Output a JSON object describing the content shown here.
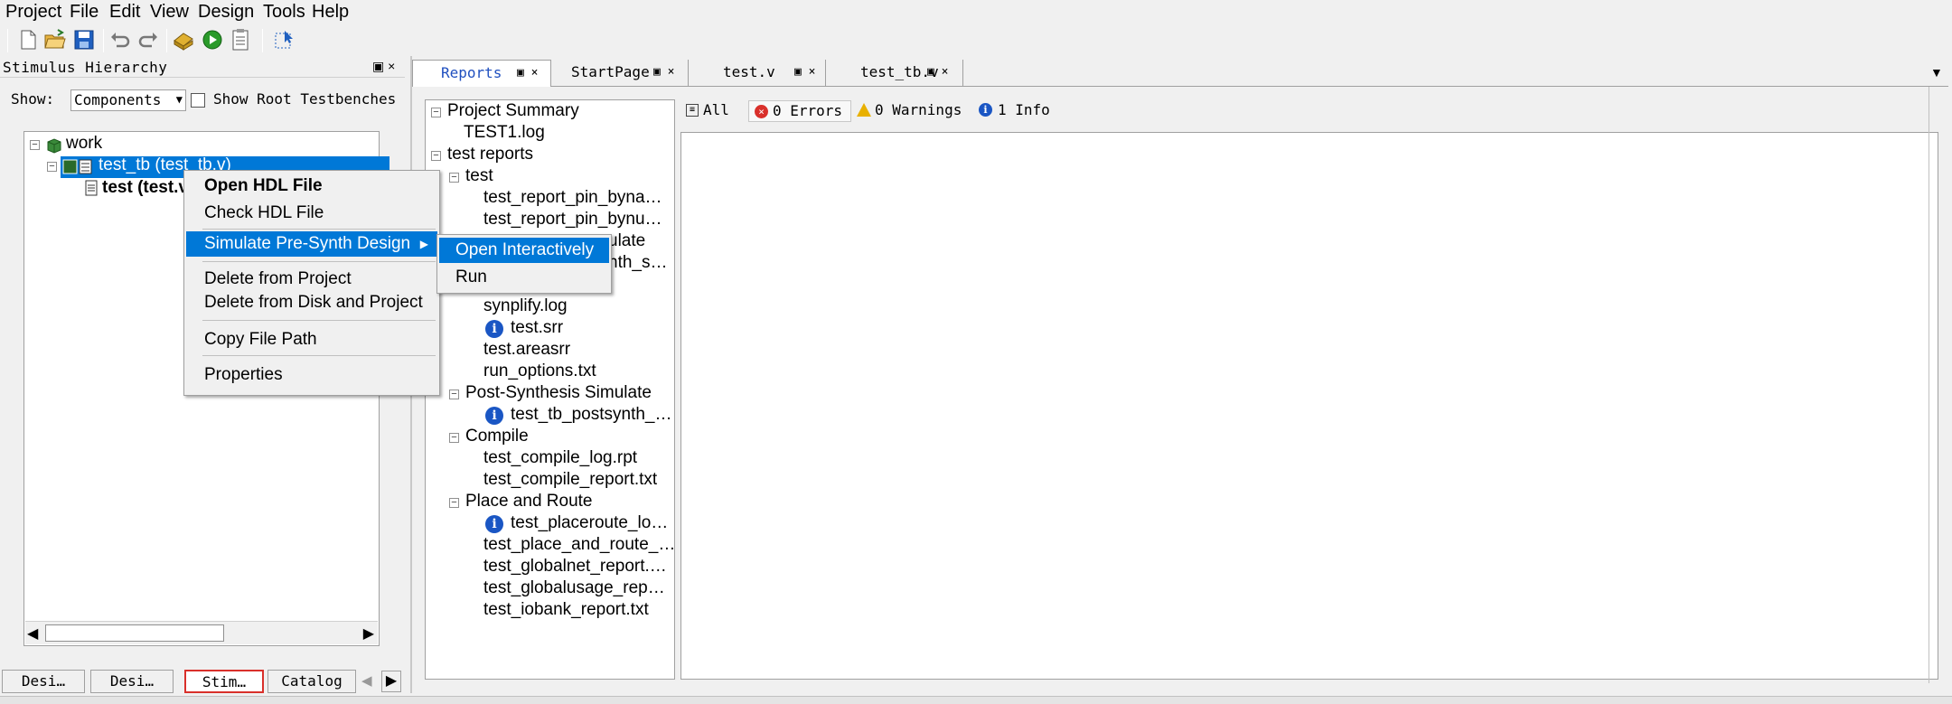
{
  "menubar": {
    "items": [
      "Project",
      "File",
      "Edit",
      "View",
      "Design",
      "Tools",
      "Help"
    ]
  },
  "toolbar": {
    "icons": [
      "new-file-icon",
      "open-folder-icon",
      "save-icon",
      "undo-icon",
      "redo-icon",
      "build-icon",
      "run-icon",
      "report-icon",
      "select-icon"
    ]
  },
  "left_panel": {
    "title": "Stimulus Hierarchy",
    "dock_label": "▣ ×",
    "show_label": "Show:",
    "show_select": "Components",
    "root_testbenches_label": "Show Root Testbenches",
    "tree": {
      "work": "work",
      "test_tb": "test_tb (test_tb.v)",
      "test_v": "test (test.v)"
    },
    "bottom_tabs": [
      "Desi…",
      "Desi…",
      "Stim…",
      "Catalog"
    ]
  },
  "context_menu": {
    "items": [
      "Open HDL File",
      "Check HDL File",
      "Simulate Pre-Synth Design",
      "Delete from Project",
      "Delete from Disk and Project",
      "Copy File Path",
      "Properties"
    ],
    "submenu": [
      "Open Interactively",
      "Run"
    ]
  },
  "right_panel": {
    "tabs": [
      {
        "label": "Reports",
        "active": true
      },
      {
        "label": "StartPage"
      },
      {
        "label": "test.v"
      },
      {
        "label": "test_tb.v"
      }
    ],
    "tab_ctrl": "▣ ×",
    "tree": {
      "project_summary": "Project Summary",
      "test1_log": "TEST1.log",
      "test_reports": "test reports",
      "test": "test",
      "pin_byna": "test_report_pin_byna…",
      "pin_bynu": "test_report_pin_bynu…",
      "ulate": "ulate",
      "nth_s": "nth_s…",
      "synplify": "synplify.log",
      "srr": "test.srr",
      "areasrr": "test.areasrr",
      "run_options": "run_options.txt",
      "post_synth": "Post-Synthesis Simulate",
      "tb_postsynth": "test_tb_postsynth_…",
      "compile": "Compile",
      "compile_log": "test_compile_log.rpt",
      "compile_report": "test_compile_report.txt",
      "place_route": "Place and Route",
      "placeroute_lo": "test_placeroute_lo…",
      "place_and_route": "test_place_and_route_…",
      "globalnet": "test_globalnet_report.…",
      "globalusage": "test_globalusage_rep…",
      "iobank": "test_iobank_report.txt"
    },
    "filters": {
      "all": "All",
      "errors": "0 Errors",
      "warnings": "0 Warnings",
      "info": "1 Info"
    }
  },
  "colors": {
    "selection": "#0078d7",
    "highlight_border": "#d9302b"
  }
}
